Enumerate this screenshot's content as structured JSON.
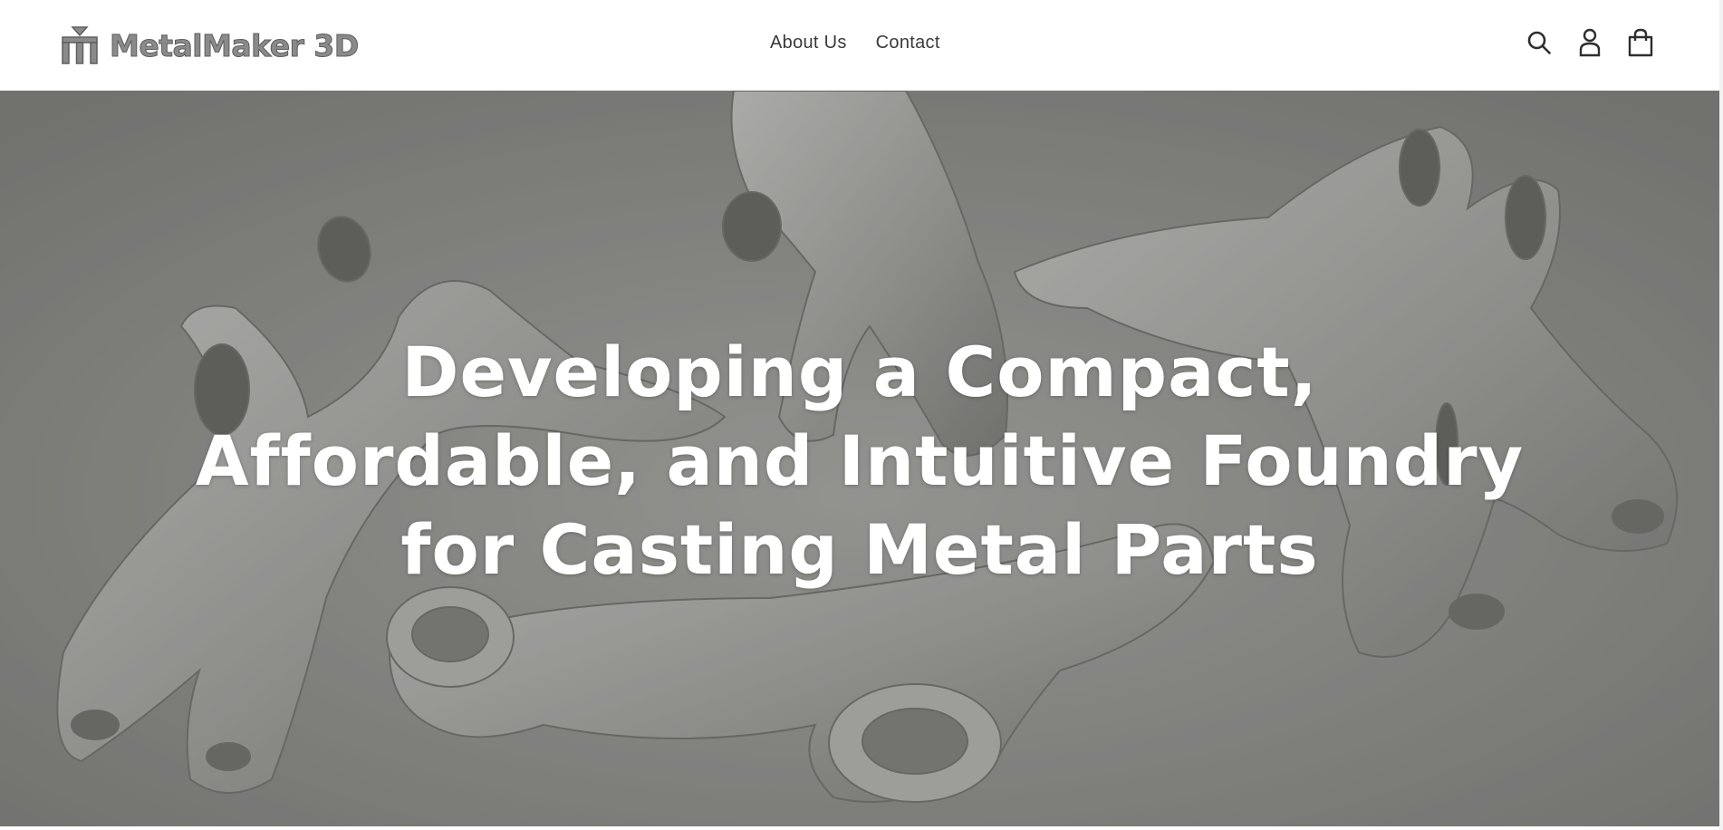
{
  "header": {
    "logo_text": "MetalMaker 3D",
    "nav": [
      {
        "label": "About Us"
      },
      {
        "label": "Contact"
      }
    ],
    "icons": [
      "search-icon",
      "account-icon",
      "cart-icon"
    ]
  },
  "hero": {
    "title": "Developing a Compact, Affordable, and Intuitive Foundry for Casting Metal Parts"
  },
  "colors": {
    "logo": "#8a8a8a",
    "nav_text": "#3a3a3a",
    "hero_text": "#ffffff",
    "hero_bg": "#8f8f8c"
  }
}
